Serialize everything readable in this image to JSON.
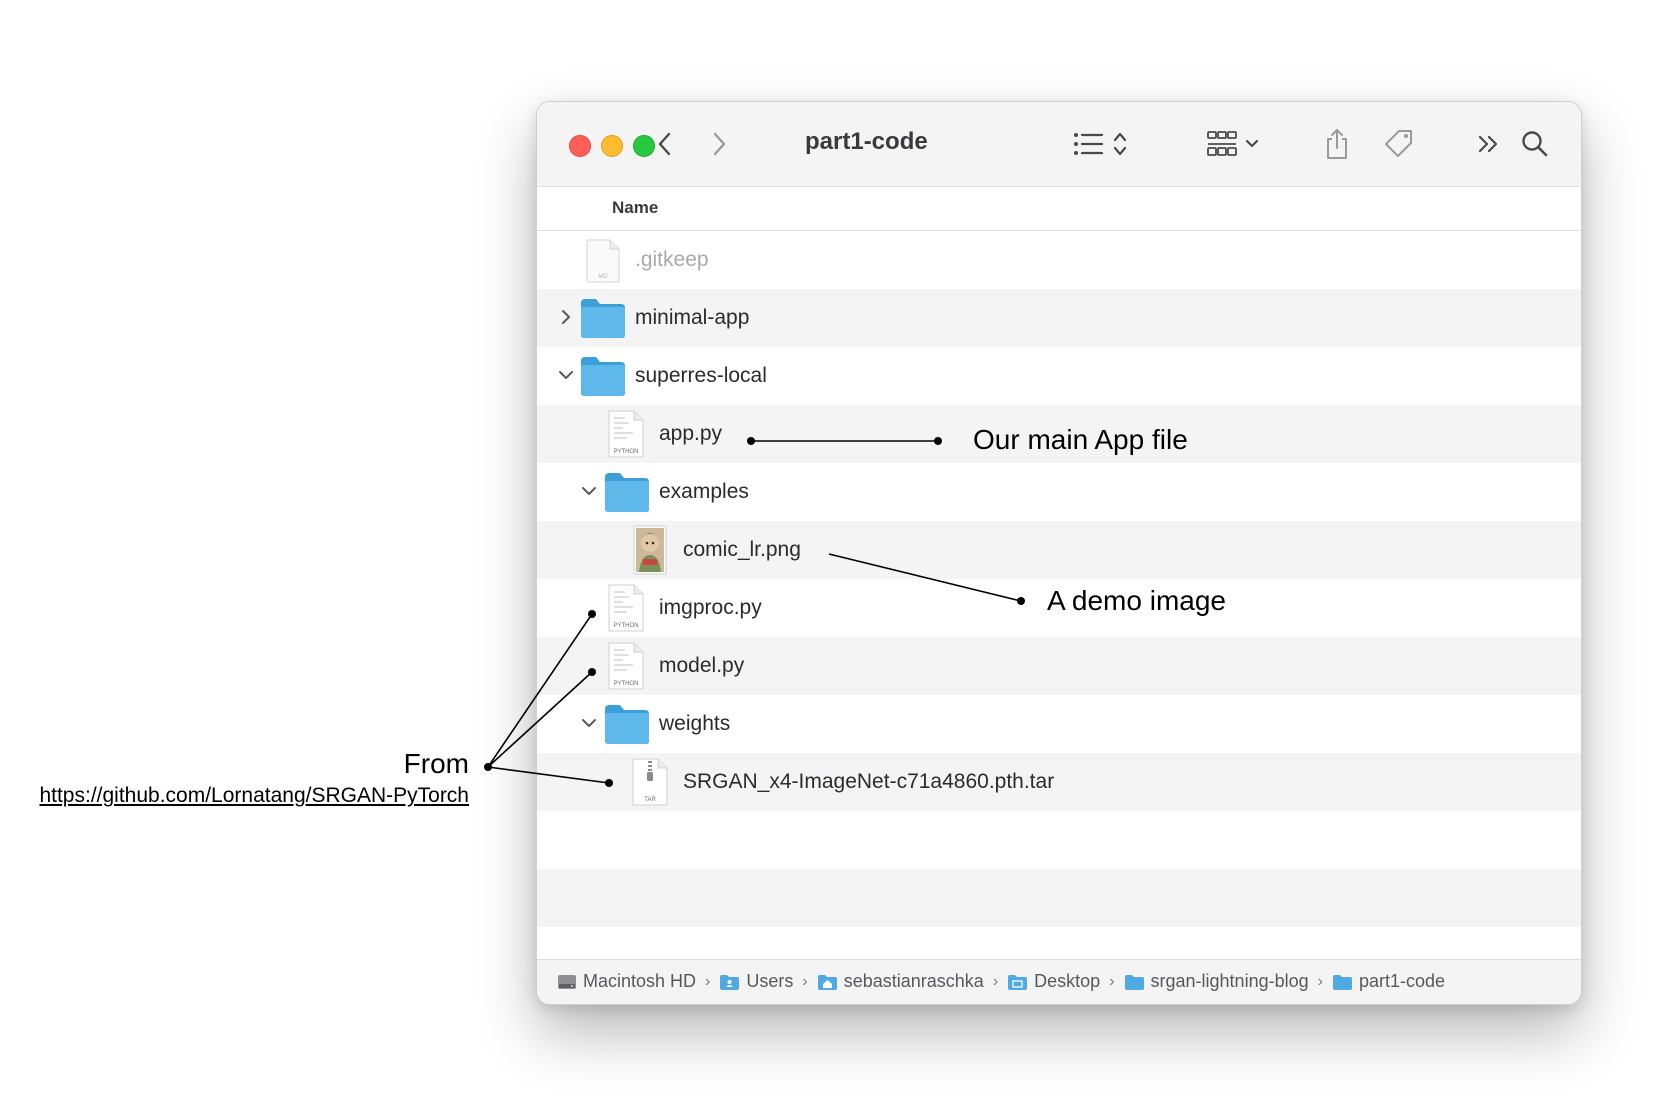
{
  "window": {
    "title": "part1-code"
  },
  "list": {
    "column_name": "Name",
    "items": [
      {
        "label": ".gitkeep",
        "icon": "md-file-icon",
        "icon_caption": "MD",
        "dim": true
      },
      {
        "label": "minimal-app",
        "icon": "folder-icon",
        "disclosure": "collapsed"
      },
      {
        "label": "superres-local",
        "icon": "folder-icon",
        "disclosure": "expanded"
      },
      {
        "label": "app.py",
        "icon": "python-file-icon",
        "icon_caption": "PYTHON"
      },
      {
        "label": "examples",
        "icon": "folder-icon",
        "disclosure": "expanded"
      },
      {
        "label": "comic_lr.png",
        "icon": "image-thumbnail-icon"
      },
      {
        "label": "imgproc.py",
        "icon": "python-file-icon",
        "icon_caption": "PYTHON"
      },
      {
        "label": "model.py",
        "icon": "python-file-icon",
        "icon_caption": "PYTHON"
      },
      {
        "label": "weights",
        "icon": "folder-icon",
        "disclosure": "expanded"
      },
      {
        "label": "SRGAN_x4-ImageNet-c71a4860.pth.tar",
        "icon": "tar-archive-icon",
        "icon_caption": "TAR"
      }
    ]
  },
  "path_bar": {
    "crumbs": [
      {
        "label": "Macintosh HD",
        "icon": "hard-drive-icon"
      },
      {
        "label": "Users",
        "icon": "users-folder-icon"
      },
      {
        "label": "sebastianraschka",
        "icon": "home-folder-icon"
      },
      {
        "label": "Desktop",
        "icon": "desktop-folder-icon"
      },
      {
        "label": "srgan-lightning-blog",
        "icon": "folder-icon"
      },
      {
        "label": "part1-code",
        "icon": "folder-icon"
      }
    ]
  },
  "annotations": {
    "main_app": "Our main App file",
    "demo_image": "A demo image",
    "from": "From",
    "link": "https://github.com/Lornatang/SRGAN-PyTorch"
  },
  "colors": {
    "close": "#ff5f57",
    "minimize": "#febc2e",
    "maximize": "#28c840",
    "folder": "#5fb8ea",
    "folder_dark": "#3c9fd8",
    "row_alt": "#f4f4f5"
  }
}
